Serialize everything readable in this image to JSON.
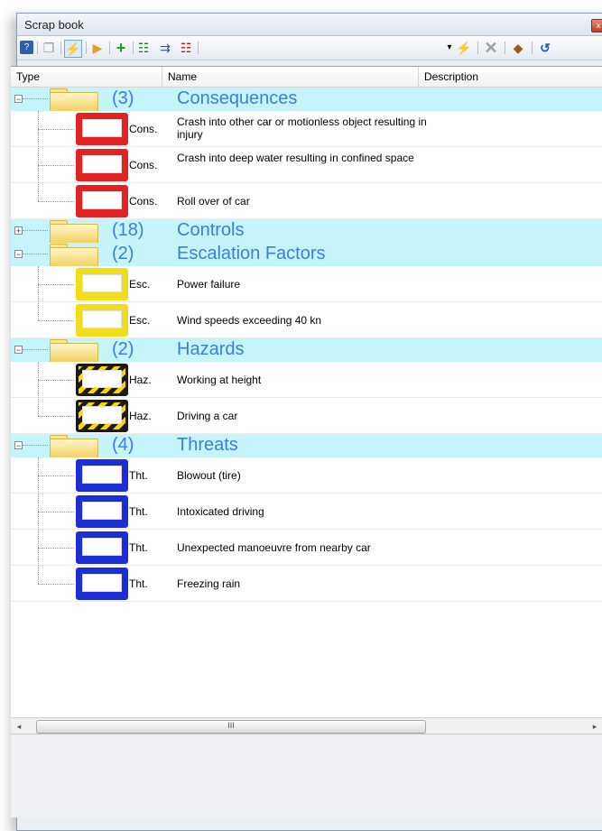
{
  "window": {
    "title": "Scrap book",
    "close_glyph": "x"
  },
  "toolbar": {
    "icons": [
      "help-icon",
      "copy-icon",
      "paste-icon",
      "open-folder-icon",
      "add-icon",
      "add-child-icon",
      "tree-icon",
      "error-icon",
      "lightning-icon",
      "delete-icon",
      "tag-icon",
      "refresh-icon"
    ],
    "dropdown_glyph": "▾"
  },
  "columns": {
    "type": "Type",
    "name": "Name",
    "description": "Description"
  },
  "groups": [
    {
      "count": "(3)",
      "name": "Consequences",
      "expanded": true,
      "items": [
        {
          "abbr": "Cons.",
          "color": "red",
          "name": "Crash into other car or motionless object resulting in injury"
        },
        {
          "abbr": "Cons.",
          "color": "red",
          "name": "Crash into deep water resulting in confined space"
        },
        {
          "abbr": "Cons.",
          "color": "red",
          "name": "Roll over of car"
        }
      ]
    },
    {
      "count": "(18)",
      "name": "Controls",
      "expanded": false,
      "items": []
    },
    {
      "count": "(2)",
      "name": "Escalation Factors",
      "expanded": true,
      "items": [
        {
          "abbr": "Esc.",
          "color": "yellow",
          "name": "Power failure"
        },
        {
          "abbr": "Esc.",
          "color": "yellow",
          "name": "Wind speeds exceeding 40 kn"
        }
      ]
    },
    {
      "count": "(2)",
      "name": "Hazards",
      "expanded": true,
      "items": [
        {
          "abbr": "Haz.",
          "color": "hazard",
          "name": "Working at height"
        },
        {
          "abbr": "Haz.",
          "color": "hazard",
          "name": "Driving a car"
        }
      ]
    },
    {
      "count": "(4)",
      "name": "Threats",
      "expanded": true,
      "items": [
        {
          "abbr": "Tht.",
          "color": "blue",
          "name": "Blowout (tire)"
        },
        {
          "abbr": "Tht.",
          "color": "blue",
          "name": "Intoxicated driving"
        },
        {
          "abbr": "Tht.",
          "color": "blue",
          "name": "Unexpected manoeuvre from nearby car"
        },
        {
          "abbr": "Tht.",
          "color": "blue",
          "name": "Freezing rain"
        }
      ]
    }
  ],
  "scrollbar": {
    "left": "◂",
    "right": "▸",
    "grip": "III"
  },
  "colors": {
    "group_bg": "#c6f4fb",
    "group_text": "#3b7fdc",
    "cons": "#e02424",
    "esc": "#f0de1c",
    "tht": "#1b2fd4"
  }
}
